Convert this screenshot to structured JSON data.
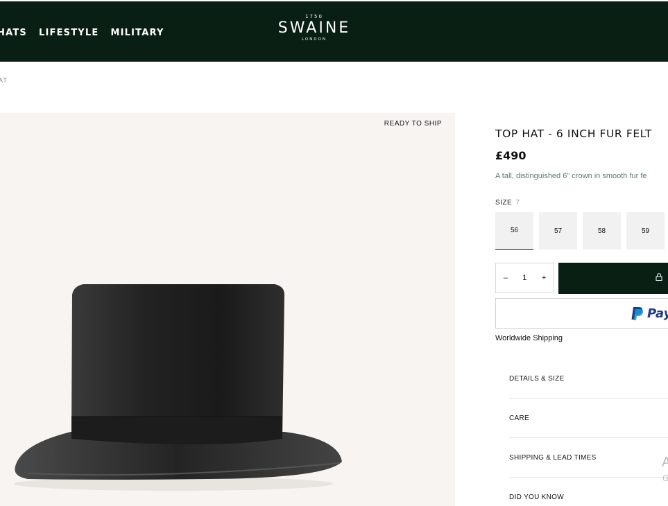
{
  "header": {
    "nav": [
      "HATS",
      "LIFESTYLE",
      "MILITARY"
    ],
    "logo": {
      "year": "1750",
      "name": "SWAINE",
      "city": "LONDON"
    }
  },
  "breadcrumb": "AT",
  "gallery": {
    "badge": "READY TO SHIP"
  },
  "product": {
    "title": "TOP HAT - 6 INCH FUR FELT",
    "price": "£490",
    "description": "A tall, distinguished 6\" crown in smooth fur fe",
    "size_label": "SIZE",
    "size_selected": "7",
    "sizes": [
      "56",
      "57",
      "58",
      "59"
    ],
    "quantity": "1",
    "paypal_label": "Pay",
    "shipping_note": "Worldwide Shipping"
  },
  "accordion": [
    "DETAILS & SIZE",
    "CARE",
    "SHIPPING & LEAD TIMES",
    "DID YOU KNOW"
  ],
  "colors": {
    "header_bg": "#0a1f14",
    "gallery_bg": "#f7f4f1",
    "desc_text": "#5d7a72",
    "paypal_blue": "#253b80"
  },
  "icons": [
    "minus-icon",
    "plus-icon",
    "lock-icon",
    "paypal-icon"
  ]
}
